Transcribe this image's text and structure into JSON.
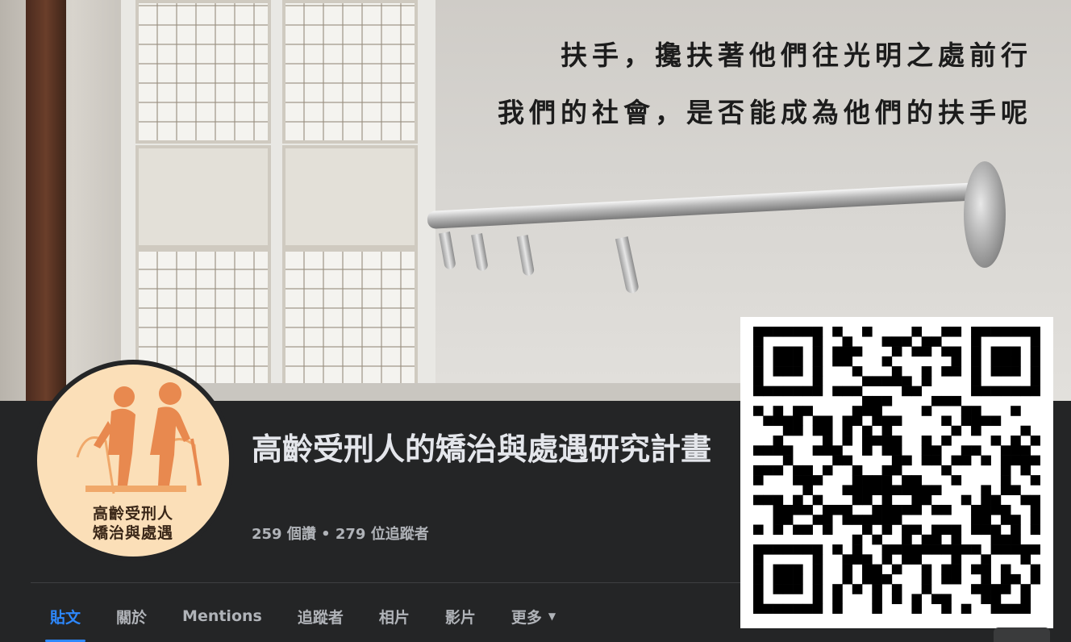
{
  "cover": {
    "slogan_line_1": "扶手，攙扶著他們往光明之處前行",
    "slogan_line_2": "我們的社會，是否能成為他們的扶手呢"
  },
  "avatar": {
    "logo_line_1": "高齡受刑人",
    "logo_line_2": "矯治與處遇"
  },
  "page": {
    "title": "高齡受刑人的矯治與處遇研究計畫",
    "stats": "259 個讚 • 279 位追蹤者"
  },
  "tabs": [
    {
      "label": "貼文",
      "active": true
    },
    {
      "label": "關於",
      "active": false
    },
    {
      "label": "Mentions",
      "active": false
    },
    {
      "label": "追蹤者",
      "active": false
    },
    {
      "label": "相片",
      "active": false
    },
    {
      "label": "影片",
      "active": false
    },
    {
      "label": "更多",
      "active": false,
      "icon": "caret-down-icon"
    }
  ],
  "colors": {
    "background": "#242526",
    "accent": "#2d88ff",
    "text_primary": "#e4e6eb",
    "text_secondary": "#b0b3b8",
    "logo_background": "#fbdfb8",
    "logo_figure": "#e8894f"
  }
}
